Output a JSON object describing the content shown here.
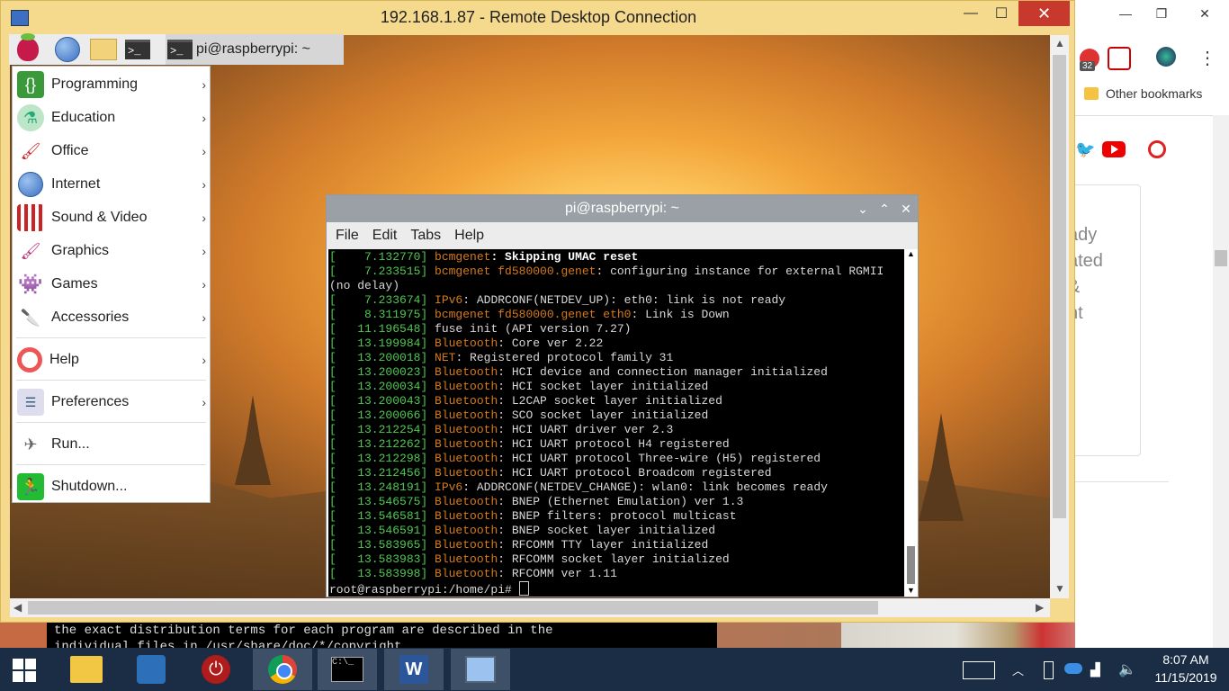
{
  "rdp": {
    "title": "192.168.1.87 - Remote Desktop Connection",
    "minimize": "—",
    "maximize": "☐",
    "close": "✕"
  },
  "pi_taskbar": {
    "task_label": "pi@raspberrypi: ~"
  },
  "pi_menu": {
    "items": [
      {
        "label": "Programming",
        "icon": "braces-icon"
      },
      {
        "label": "Education",
        "icon": "flask-icon"
      },
      {
        "label": "Office",
        "icon": "office-icon"
      },
      {
        "label": "Internet",
        "icon": "globe-icon"
      },
      {
        "label": "Sound & Video",
        "icon": "media-icon"
      },
      {
        "label": "Graphics",
        "icon": "paintbrush-icon"
      },
      {
        "label": "Games",
        "icon": "invader-icon"
      },
      {
        "label": "Accessories",
        "icon": "knife-icon"
      },
      {
        "label": "Help",
        "icon": "lifebuoy-icon"
      },
      {
        "label": "Preferences",
        "icon": "sliders-icon"
      },
      {
        "label": "Run...",
        "icon": "paperplane-icon"
      },
      {
        "label": "Shutdown...",
        "icon": "exit-icon"
      }
    ]
  },
  "terminal": {
    "title": "pi@raspberrypi: ~",
    "menu": [
      "File",
      "Edit",
      "Tabs",
      "Help"
    ],
    "lines": [
      {
        "ts": "    7.132770",
        "src": "bcmgenet",
        "msg": ": Skipping UMAC reset",
        "bold": true
      },
      {
        "ts": "    7.233515",
        "src": "bcmgenet fd580000.genet",
        "msg": ": configuring instance for external RGMII"
      },
      {
        "plain": "(no delay)"
      },
      {
        "ts": "    7.233674",
        "src": "IPv6",
        "msg": ": ADDRCONF(NETDEV_UP): eth0: link is not ready"
      },
      {
        "ts": "    8.311975",
        "src": "bcmgenet fd580000.genet eth0",
        "msg": ": Link is Down"
      },
      {
        "ts": "   11.196548",
        "src": "",
        "msg": "fuse init (API version 7.27)"
      },
      {
        "ts": "   13.199984",
        "src": "Bluetooth",
        "msg": ": Core ver 2.22"
      },
      {
        "ts": "   13.200018",
        "src": "NET",
        "msg": ": Registered protocol family 31"
      },
      {
        "ts": "   13.200023",
        "src": "Bluetooth",
        "msg": ": HCI device and connection manager initialized"
      },
      {
        "ts": "   13.200034",
        "src": "Bluetooth",
        "msg": ": HCI socket layer initialized"
      },
      {
        "ts": "   13.200043",
        "src": "Bluetooth",
        "msg": ": L2CAP socket layer initialized"
      },
      {
        "ts": "   13.200066",
        "src": "Bluetooth",
        "msg": ": SCO socket layer initialized"
      },
      {
        "ts": "   13.212254",
        "src": "Bluetooth",
        "msg": ": HCI UART driver ver 2.3"
      },
      {
        "ts": "   13.212262",
        "src": "Bluetooth",
        "msg": ": HCI UART protocol H4 registered"
      },
      {
        "ts": "   13.212298",
        "src": "Bluetooth",
        "msg": ": HCI UART protocol Three-wire (H5) registered"
      },
      {
        "ts": "   13.212456",
        "src": "Bluetooth",
        "msg": ": HCI UART protocol Broadcom registered"
      },
      {
        "ts": "   13.248191",
        "src": "IPv6",
        "msg": ": ADDRCONF(NETDEV_CHANGE): wlan0: link becomes ready"
      },
      {
        "ts": "   13.546575",
        "src": "Bluetooth",
        "msg": ": BNEP (Ethernet Emulation) ver 1.3"
      },
      {
        "ts": "   13.546581",
        "src": "Bluetooth",
        "msg": ": BNEP filters: protocol multicast"
      },
      {
        "ts": "   13.546591",
        "src": "Bluetooth",
        "msg": ": BNEP socket layer initialized"
      },
      {
        "ts": "   13.583965",
        "src": "Bluetooth",
        "msg": ": RFCOMM TTY layer initialized"
      },
      {
        "ts": "   13.583983",
        "src": "Bluetooth",
        "msg": ": RFCOMM socket layer initialized"
      },
      {
        "ts": "   13.583998",
        "src": "Bluetooth",
        "msg": ": RFCOMM ver 1.11"
      }
    ],
    "prompt": "root@raspberrypi:/home/pi# "
  },
  "background_terminal": {
    "line1": "the exact distribution terms for each program are described in the",
    "line2": "individual files in /usr/share/doc/*/copyright."
  },
  "chrome": {
    "badge": "32",
    "other_bookmarks": "Other bookmarks",
    "page_fragments": [
      "ady",
      "ated",
      "&",
      "nt"
    ]
  },
  "clock": {
    "time": "8:07 AM",
    "date": "11/15/2019"
  },
  "colors": {
    "timestamp": "#4ec94e",
    "source": "#d47a1a",
    "rdp_frame": "#f5d98c",
    "win_taskbar": "#1a2d44"
  }
}
